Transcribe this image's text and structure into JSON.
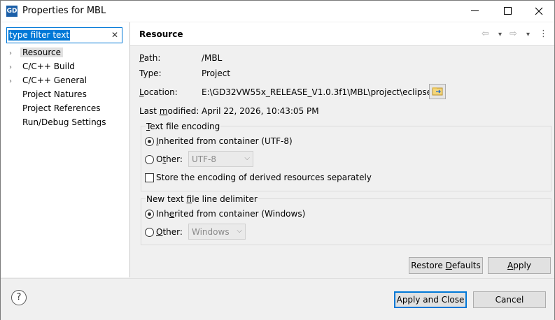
{
  "window": {
    "app_icon_text": "GD",
    "title": "Properties for MBL",
    "minimize_glyph": "—",
    "maximize_glyph": "☐",
    "close_glyph": "✕"
  },
  "filter": {
    "value": "type filter text",
    "clear_glyph": "✕"
  },
  "tree": {
    "items": [
      {
        "label": "Resource",
        "arrow": "›",
        "selected": true
      },
      {
        "label": "C/C++ Build",
        "arrow": "›"
      },
      {
        "label": "C/C++ General",
        "arrow": "›"
      },
      {
        "label": "Project Natures",
        "arrow": ""
      },
      {
        "label": "Project References",
        "arrow": ""
      },
      {
        "label": "Run/Debug Settings",
        "arrow": ""
      }
    ]
  },
  "header": {
    "title": "Resource",
    "back_glyph": "⇦",
    "back_menu_glyph": "▾",
    "forward_glyph": "⇨",
    "forward_menu_glyph": "▾",
    "menu_glyph": "⋮"
  },
  "info": {
    "path_label_u": "P",
    "path_label_rest": "ath:",
    "path_value": "/MBL",
    "type_label": "Type:",
    "type_value": "Project",
    "location_label_u": "L",
    "location_label_rest": "ocation:",
    "location_value": "E:\\GD32VW55x_RELEASE_V1.0.3f1\\MBL\\project\\eclipse",
    "modified_label_pre": "Last ",
    "modified_label_u": "m",
    "modified_label_rest": "odified:",
    "modified_value": "April 22, 2026, 10:43:05 PM"
  },
  "encoding": {
    "title_u": "T",
    "title_rest": "ext file encoding",
    "inherited_label_u": "I",
    "inherited_label_rest": "nherited from container (UTF-8)",
    "other_label_pre": "O",
    "other_label_u": "t",
    "other_label_rest": "her:",
    "other_value": "UTF-8",
    "store_label": "Store the encoding of derived resources separately",
    "combo_arrow": "⌵"
  },
  "delimiter": {
    "title_pre": "New text ",
    "title_u": "f",
    "title_rest": "ile line delimiter",
    "inherited_label_pre": "Inh",
    "inherited_label_u": "e",
    "inherited_label_rest": "rited from container (Windows)",
    "other_label_u": "O",
    "other_label_rest": "ther:",
    "other_value": "Windows",
    "combo_arrow": "⌵"
  },
  "buttons": {
    "restore_pre": "Restore ",
    "restore_u": "D",
    "restore_rest": "efaults",
    "apply_u": "A",
    "apply_rest": "pply",
    "apply_close": "Apply and Close",
    "cancel": "Cancel",
    "help_glyph": "?"
  }
}
